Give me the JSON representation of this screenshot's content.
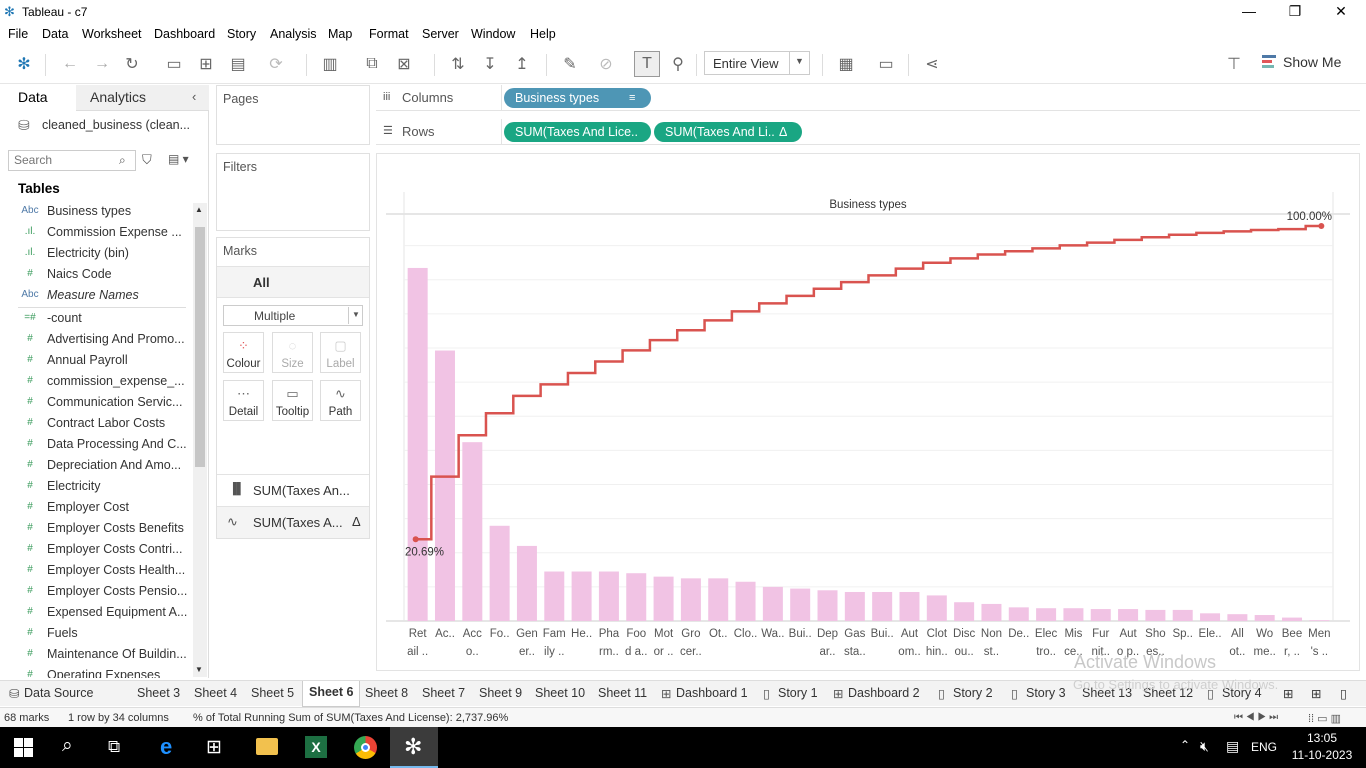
{
  "window": {
    "title": "Tableau - c7"
  },
  "menu": [
    "File",
    "Data",
    "Worksheet",
    "Dashboard",
    "Story",
    "Analysis",
    "Map",
    "Format",
    "Server",
    "Window",
    "Help"
  ],
  "toolbar": {
    "fit": "Entire View",
    "show_me": "Show Me"
  },
  "left": {
    "tabs": [
      "Data",
      "Analytics"
    ],
    "datasource": "cleaned_business (clean...",
    "search_placeholder": "Search",
    "tables_heading": "Tables",
    "fields": [
      {
        "icon": "Abc",
        "label": "Business types",
        "italic": false
      },
      {
        "icon": ".ıl.",
        "label": "Commission Expense ...",
        "italic": false
      },
      {
        "icon": ".ıl.",
        "label": "Electricity (bin)",
        "italic": false
      },
      {
        "icon": "#",
        "label": "Naics Code",
        "italic": false
      },
      {
        "icon": "Abc",
        "label": "Measure Names",
        "italic": true
      },
      {
        "icon": "=#",
        "label": "-count",
        "italic": false
      },
      {
        "icon": "#",
        "label": "Advertising And Promo...",
        "italic": false
      },
      {
        "icon": "#",
        "label": "Annual Payroll",
        "italic": false
      },
      {
        "icon": "#",
        "label": "commission_expense_...",
        "italic": false
      },
      {
        "icon": "#",
        "label": "Communication Servic...",
        "italic": false
      },
      {
        "icon": "#",
        "label": "Contract Labor Costs",
        "italic": false
      },
      {
        "icon": "#",
        "label": "Data Processing And C...",
        "italic": false
      },
      {
        "icon": "#",
        "label": "Depreciation And Amo...",
        "italic": false
      },
      {
        "icon": "#",
        "label": "Electricity",
        "italic": false
      },
      {
        "icon": "#",
        "label": "Employer Cost",
        "italic": false
      },
      {
        "icon": "#",
        "label": "Employer Costs Benefits",
        "italic": false
      },
      {
        "icon": "#",
        "label": "Employer Costs Contri...",
        "italic": false
      },
      {
        "icon": "#",
        "label": "Employer Costs Health...",
        "italic": false
      },
      {
        "icon": "#",
        "label": "Employer Costs Pensio...",
        "italic": false
      },
      {
        "icon": "#",
        "label": "Expensed Equipment A...",
        "italic": false
      },
      {
        "icon": "#",
        "label": "Fuels",
        "italic": false
      },
      {
        "icon": "#",
        "label": "Maintenance Of Buildin...",
        "italic": false
      },
      {
        "icon": "#",
        "label": "Operating Expenses",
        "italic": false
      }
    ]
  },
  "cards": {
    "pages": "Pages",
    "filters": "Filters",
    "marks": "Marks",
    "all": "All",
    "mark_type": "Multiple",
    "buttons": [
      "Colour",
      "Size",
      "Label",
      "Detail",
      "Tooltip",
      "Path"
    ],
    "measure_rows": [
      "SUM(Taxes An...",
      "SUM(Taxes A..."
    ],
    "delta": "Δ"
  },
  "shelves": {
    "columns_label": "Columns",
    "rows_label": "Rows",
    "columns_pill": "Business types",
    "rows_pills": [
      "SUM(Taxes And Lice..",
      "SUM(Taxes And Li.."
    ]
  },
  "chart_data": {
    "type": "bar",
    "title": "Business types",
    "categories": [
      "Ret ail ..",
      "Ac..",
      "Acc o..",
      "Fo..",
      "Gen er..",
      "Fam ily ..",
      "He..",
      "Pha rm..",
      "Foo d a..",
      "Mot or ..",
      "Gro cer..",
      "Ot..",
      "Clo..",
      "Wa..",
      "Bui..",
      "Dep ar..",
      "Gas sta..",
      "Bui..",
      "Aut om..",
      "Clot hin..",
      "Disc ou..",
      "Non st..",
      "De..",
      "Elec tro..",
      "Mis ce..",
      "Fur nit..",
      "Aut o p..",
      "Sho es..",
      "Sp..",
      "Ele..",
      "All ot..",
      "Wo me..",
      "Bee r, ..",
      "Men 's .."
    ],
    "series": [
      {
        "type": "bar",
        "values": [
          20.69,
          15.85,
          10.48,
          5.58,
          4.4,
          2.9,
          2.9,
          2.9,
          2.8,
          2.6,
          2.5,
          2.5,
          2.3,
          2.0,
          1.9,
          1.8,
          1.7,
          1.7,
          1.7,
          1.5,
          1.1,
          1.0,
          0.8,
          0.75,
          0.75,
          0.7,
          0.7,
          0.65,
          0.65,
          0.45,
          0.4,
          0.35,
          0.2,
          0.05
        ]
      },
      {
        "type": "line",
        "values": [
          20.69,
          36.54,
          47.02,
          52.6,
          57.0,
          59.9,
          62.8,
          65.7,
          68.5,
          71.1,
          73.6,
          76.1,
          78.4,
          80.4,
          82.3,
          84.1,
          85.8,
          87.5,
          89.2,
          90.7,
          91.8,
          92.8,
          93.6,
          94.35,
          95.1,
          95.8,
          96.5,
          97.15,
          97.8,
          98.25,
          98.65,
          99.0,
          99.2,
          100.0
        ]
      }
    ],
    "labels": [
      "20.69%",
      "100.00%"
    ],
    "colors": {
      "bar": "#f1c3e4",
      "line": "#d9534f"
    }
  },
  "sheet_tabs": [
    "Data Source",
    "Sheet 3",
    "Sheet 4",
    "Sheet 5",
    "Sheet 6",
    "Sheet 8",
    "Sheet 7",
    "Sheet 9",
    "Sheet 10",
    "Sheet 11",
    "Dashboard 1",
    "Story 1",
    "Dashboard 2",
    "Story 2",
    "Story 3",
    "Sheet 13",
    "Sheet 12",
    "Story 4"
  ],
  "status": {
    "marks": "68 marks",
    "dims": "1 row  by  34 columns",
    "summary": "% of Total Running Sum of SUM(Taxes And License): 2,737.96%"
  },
  "watermark": {
    "line1": "Activate Windows",
    "line2": "Go to Settings to activate Windows."
  },
  "taskbar": {
    "time": "13:05",
    "date": "11-10-2023",
    "lang": "ENG"
  }
}
